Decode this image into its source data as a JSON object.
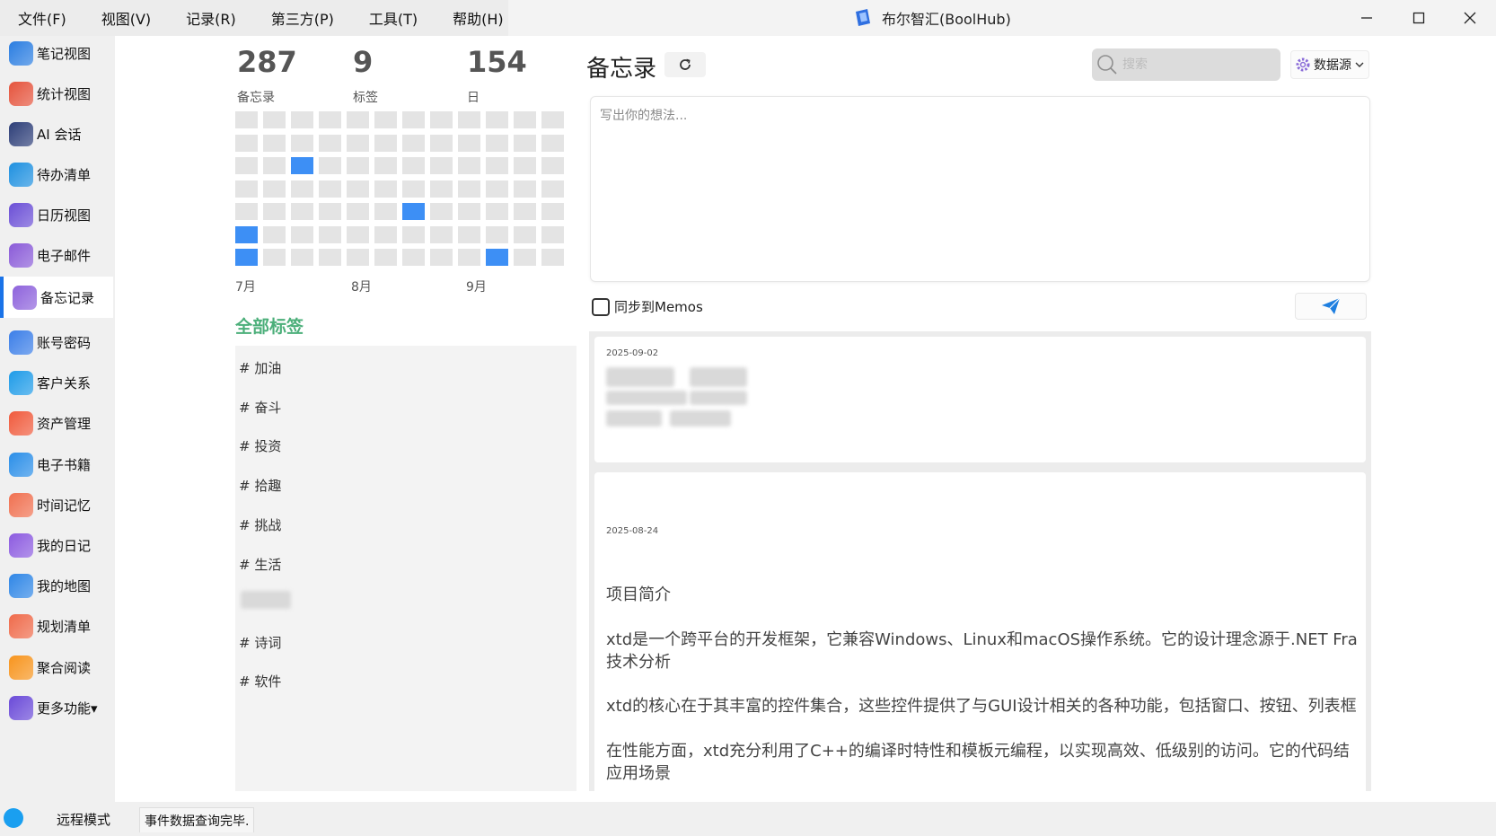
{
  "window": {
    "title": "布尔智汇(BoolHub)",
    "menu": [
      "文件(F)",
      "视图(V)",
      "记录(R)",
      "第三方(P)",
      "工具(T)",
      "帮助(H)"
    ]
  },
  "sidebar": {
    "items": [
      {
        "label": "笔记视图",
        "icon": "notes-icon",
        "color": "#2a7de1"
      },
      {
        "label": "统计视图",
        "icon": "stats-icon",
        "color": "#e5533c"
      },
      {
        "label": "AI 会话",
        "icon": "robot-icon",
        "color": "#2d3e78"
      },
      {
        "label": "待办清单",
        "icon": "todo-icon",
        "color": "#1e90e0"
      },
      {
        "label": "日历视图",
        "icon": "calendar-icon",
        "color": "#6b4fd6"
      },
      {
        "label": "电子邮件",
        "icon": "mail-icon",
        "color": "#8a5bd8"
      },
      {
        "label": "备忘记录",
        "icon": "memo-icon",
        "color": "#8e63dc",
        "active": true
      },
      {
        "label": "账号密码",
        "icon": "account-icon",
        "color": "#3b7ee8"
      },
      {
        "label": "客户关系",
        "icon": "customer-icon",
        "color": "#1e9be8"
      },
      {
        "label": "资产管理",
        "icon": "asset-icon",
        "color": "#f05a3c"
      },
      {
        "label": "电子书籍",
        "icon": "ebook-icon",
        "color": "#2a8ee8"
      },
      {
        "label": "时间记忆",
        "icon": "time-icon",
        "color": "#f07050"
      },
      {
        "label": "我的日记",
        "icon": "diary-icon",
        "color": "#8c5be0"
      },
      {
        "label": "我的地图",
        "icon": "map-icon",
        "color": "#2f86e6"
      },
      {
        "label": "规划清单",
        "icon": "plan-icon",
        "color": "#ef6a4a"
      },
      {
        "label": "聚合阅读",
        "icon": "rss-icon",
        "color": "#f7941d"
      },
      {
        "label": "更多功能▾",
        "icon": "more-icon",
        "color": "#6a4ad8"
      }
    ]
  },
  "stats": [
    {
      "value": "287",
      "label": "备忘录"
    },
    {
      "value": "9",
      "label": "标签"
    },
    {
      "value": "154",
      "label": "日"
    }
  ],
  "heatmap": {
    "months": [
      "7月",
      "8月",
      "9月"
    ],
    "active_color": "#3d8ff5",
    "empty_color": "#e4e4e4"
  },
  "tags": {
    "title": "全部标签",
    "items": [
      "# 加油",
      "# 奋斗",
      "# 投资",
      "# 拾趣",
      "# 挑战",
      "# 生活",
      "",
      "# 诗词",
      "# 软件"
    ]
  },
  "memo": {
    "title": "备忘录",
    "search_placeholder": "搜索",
    "datasource_label": "数据源",
    "editor_placeholder": "写出你的想法...",
    "sync_label": "同步到Memos",
    "cards": [
      {
        "date": "2025-09-02",
        "lines": []
      },
      {
        "date": "2025-08-24",
        "lines": [
          "项目简介",
          "xtd是一个跨平台的开发框架，它兼容Windows、Linux和macOS操作系统。它的设计理念源于.NET Fra",
          "技术分析",
          "xtd的核心在于其丰富的控件集合，这些控件提供了与GUI设计相关的各种功能，包括窗口、按钮、列表框",
          "在性能方面，xtd充分利用了C++的编译时特性和模板元编程，以实现高效、低级别的访问。它的代码结",
          "应用场景"
        ]
      }
    ]
  },
  "statusbar": {
    "mode": "远程模式",
    "message": "事件数据查询完毕."
  }
}
